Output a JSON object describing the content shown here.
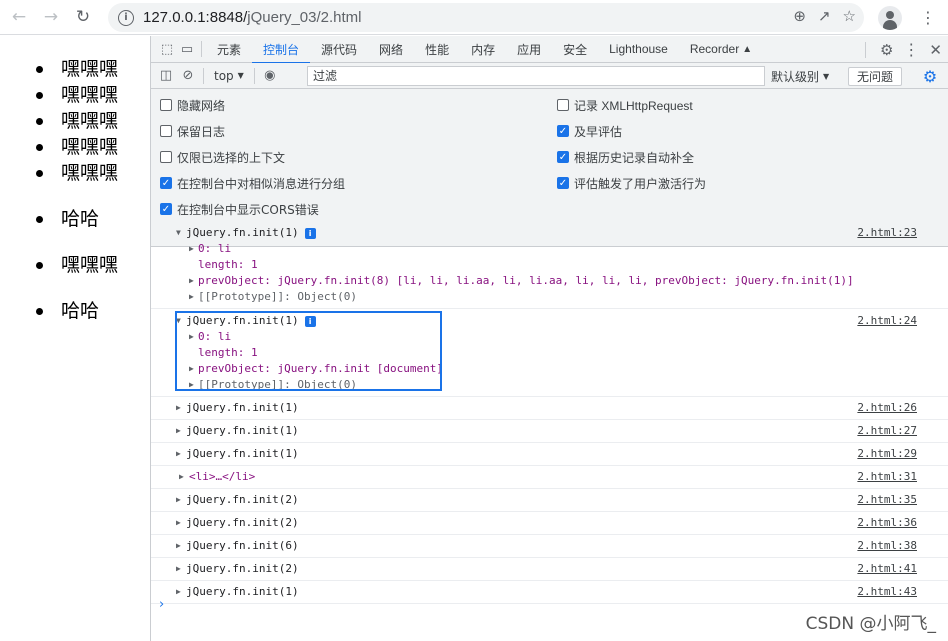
{
  "browser": {
    "url_host": "127.0.0.1:8848/",
    "url_path": "jQuery_03/2.html"
  },
  "page": {
    "items_group": [
      "嘿嘿嘿",
      "嘿嘿嘿",
      "嘿嘿嘿",
      "嘿嘿嘿",
      "嘿嘿嘿"
    ],
    "solo_items": [
      "哈哈",
      "嘿嘿嘿",
      "哈哈"
    ]
  },
  "devtools": {
    "tabs": [
      "元素",
      "控制台",
      "源代码",
      "网络",
      "性能",
      "内存",
      "应用",
      "安全",
      "Lighthouse",
      "Recorder"
    ],
    "active_tab": "控制台",
    "context": "top",
    "filter_placeholder": "过滤",
    "levels": "默认级别",
    "no_issues": "无问题",
    "settings": {
      "left": [
        {
          "label": "隐藏网络",
          "checked": false
        },
        {
          "label": "保留日志",
          "checked": false
        },
        {
          "label": "仅限已选择的上下文",
          "checked": false
        },
        {
          "label": "在控制台中对相似消息进行分组",
          "checked": true
        },
        {
          "label": "在控制台中显示CORS错误",
          "checked": true
        }
      ],
      "right": [
        {
          "label": "记录 XMLHttpRequest",
          "checked": false
        },
        {
          "label": "及早评估",
          "checked": true
        },
        {
          "label": "根据历史记录自动补全",
          "checked": true
        },
        {
          "label": "评估触发了用户激活行为",
          "checked": true
        }
      ]
    },
    "messages": [
      {
        "head": "jQuery.fn.init(1)",
        "source": "2.html:23",
        "lines": [
          "0: li",
          "length: 1",
          "prevObject: jQuery.fn.init(8) [li, li, li.aa, li, li.aa, li, li, li, prevObject: jQuery.fn.init(1)]",
          "[[Prototype]]: Object(0)"
        ]
      },
      {
        "head": "jQuery.fn.init(1)",
        "source": "2.html:24",
        "lines": [
          "0: li",
          "length: 1",
          "prevObject: jQuery.fn.init [document]",
          "[[Prototype]]: Object(0)"
        ]
      }
    ],
    "collapsed": [
      {
        "text": "jQuery.fn.init(1)",
        "source": "2.html:26"
      },
      {
        "text": "jQuery.fn.init(1)",
        "source": "2.html:27"
      },
      {
        "text": "jQuery.fn.init(1)",
        "source": "2.html:29"
      },
      {
        "text": "<li>…</li>",
        "source": "2.html:31"
      },
      {
        "text": "jQuery.fn.init(2)",
        "source": "2.html:35"
      },
      {
        "text": "jQuery.fn.init(2)",
        "source": "2.html:36"
      },
      {
        "text": "jQuery.fn.init(6)",
        "source": "2.html:38"
      },
      {
        "text": "jQuery.fn.init(2)",
        "source": "2.html:41"
      },
      {
        "text": "jQuery.fn.init(1)",
        "source": "2.html:43"
      }
    ]
  },
  "watermark": "CSDN @小阿飞_"
}
